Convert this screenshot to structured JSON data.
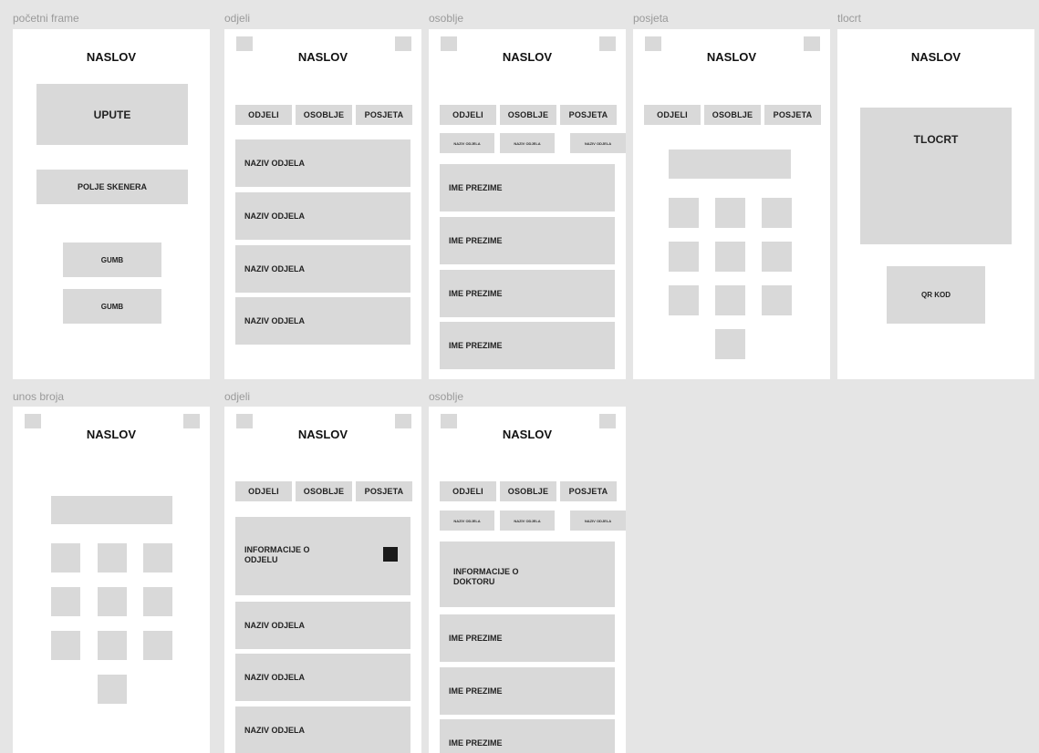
{
  "frames": {
    "pocetni": {
      "label": "početni frame",
      "title": "NASLOV",
      "instructions": "UPUTE",
      "scanner": "POLJE SKENERA",
      "button1": "GUMB",
      "button2": "GUMB"
    },
    "odjeli": {
      "label": "odjeli",
      "title": "NASLOV",
      "tabs": [
        "ODJELI",
        "OSOBLJE",
        "POSJETA"
      ],
      "items": [
        "NAZIV ODJELA",
        "NAZIV ODJELA",
        "NAZIV ODJELA",
        "NAZIV ODJELA"
      ]
    },
    "osoblje": {
      "label": "osoblje",
      "title": "NASLOV",
      "tabs": [
        "ODJELI",
        "OSOBLJE",
        "POSJETA"
      ],
      "subtabs": [
        "NAZIV ODJELA",
        "NAZIV ODJELA",
        "NAZIV ODJELA"
      ],
      "items": [
        "IME PREZIME",
        "IME PREZIME",
        "IME PREZIME",
        "IME PREZIME"
      ]
    },
    "posjeta": {
      "label": "posjeta",
      "title": "NASLOV",
      "tabs": [
        "ODJELI",
        "OSOBLJE",
        "POSJETA"
      ]
    },
    "tlocrt": {
      "label": "tlocrt",
      "title": "NASLOV",
      "map": "TLOCRT",
      "qr": "QR KOD"
    },
    "unos": {
      "label": "unos broja",
      "title": "NASLOV"
    },
    "odjeli2": {
      "label": "odjeli",
      "title": "NASLOV",
      "tabs": [
        "ODJELI",
        "OSOBLJE",
        "POSJETA"
      ],
      "info": "INFORMACIJE O ODJELU",
      "items": [
        "NAZIV ODJELA",
        "NAZIV ODJELA",
        "NAZIV ODJELA"
      ]
    },
    "osoblje2": {
      "label": "osoblje",
      "title": "NASLOV",
      "tabs": [
        "ODJELI",
        "OSOBLJE",
        "POSJETA"
      ],
      "subtabs": [
        "NAZIV ODJELA",
        "NAZIV ODJELA",
        "NAZIV ODJELA"
      ],
      "info": "INFORMACIJE O DOKTORU",
      "items": [
        "IME PREZIME",
        "IME PREZIME",
        "IME PREZIME"
      ]
    }
  }
}
